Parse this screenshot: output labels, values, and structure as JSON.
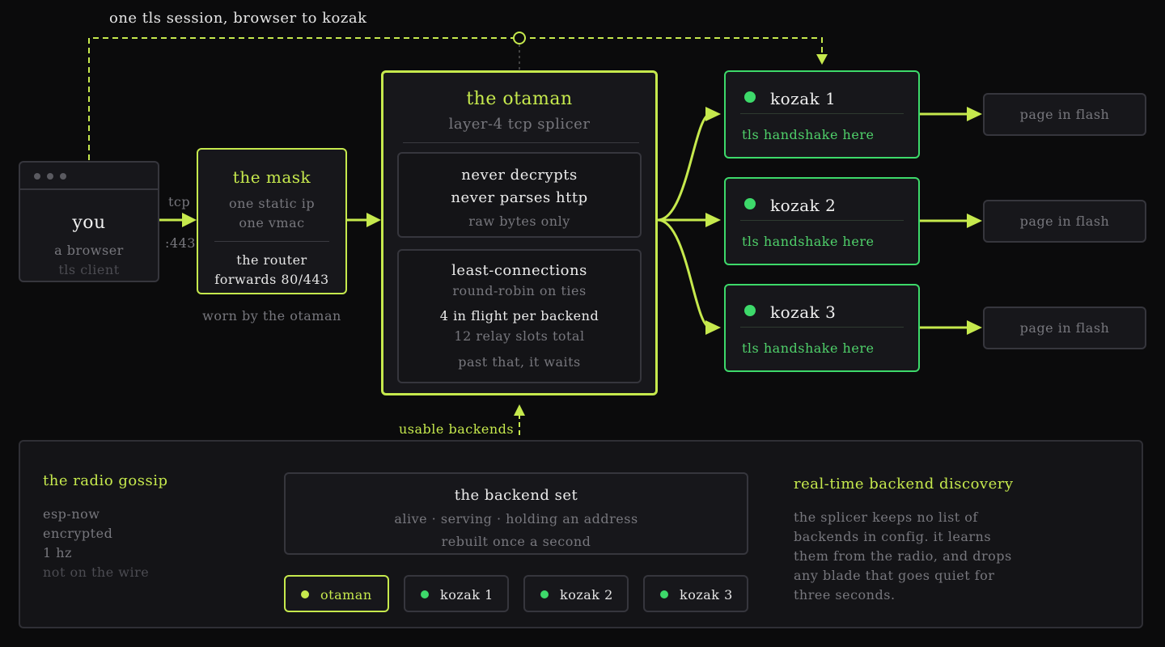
{
  "top_arc": {
    "label": "one tls session, browser to kozak"
  },
  "you": {
    "title": "you",
    "sub1": "a browser",
    "sub2": "tls client"
  },
  "tcp_label": {
    "top": "tcp",
    "bottom": ":443"
  },
  "mask": {
    "title": "the mask",
    "line1": "one static ip",
    "line2": "one vmac",
    "line3": "the router",
    "line4": "forwards 80/443",
    "caption": "worn by the otaman"
  },
  "otaman": {
    "title": "the otaman",
    "subtitle": "layer-4 tcp splicer",
    "panel1": {
      "l1": "never decrypts",
      "l2": "never parses http",
      "l3": "raw bytes only"
    },
    "panel2": {
      "l1": "least-connections",
      "l2": "round-robin on ties",
      "l3": "4 in flight per backend",
      "l4": "12 relay slots total",
      "l5": "past that, it waits"
    },
    "below_label": "usable backends"
  },
  "kozaks": [
    {
      "name": "kozak 1",
      "note": "tls handshake here",
      "target": "page in flash"
    },
    {
      "name": "kozak 2",
      "note": "tls handshake here",
      "target": "page in flash"
    },
    {
      "name": "kozak 3",
      "note": "tls handshake here",
      "target": "page in flash"
    }
  ],
  "gossip": {
    "title": "the radio gossip",
    "l1": "esp-now",
    "l2": "encrypted",
    "l3": "1 hz",
    "l4": "not on the wire"
  },
  "backend_set": {
    "title": "the backend set",
    "line1": "alive · serving · holding an address",
    "line2": "rebuilt once a second",
    "nodes": [
      "otaman",
      "kozak 1",
      "kozak 2",
      "kozak 3"
    ]
  },
  "discovery": {
    "title": "real-time backend discovery",
    "l1": "the splicer keeps no list of",
    "l2": "backends in config. it learns",
    "l3": "them from the radio, and drops",
    "l4": "any blade that goes quiet for",
    "l5": "three seconds."
  },
  "colors": {
    "background": "#0b0b0c",
    "accent_lime": "#c6e94d",
    "accent_green": "#4fd06a",
    "dot_green": "#3dd96a",
    "box_fill": "#17171b"
  }
}
